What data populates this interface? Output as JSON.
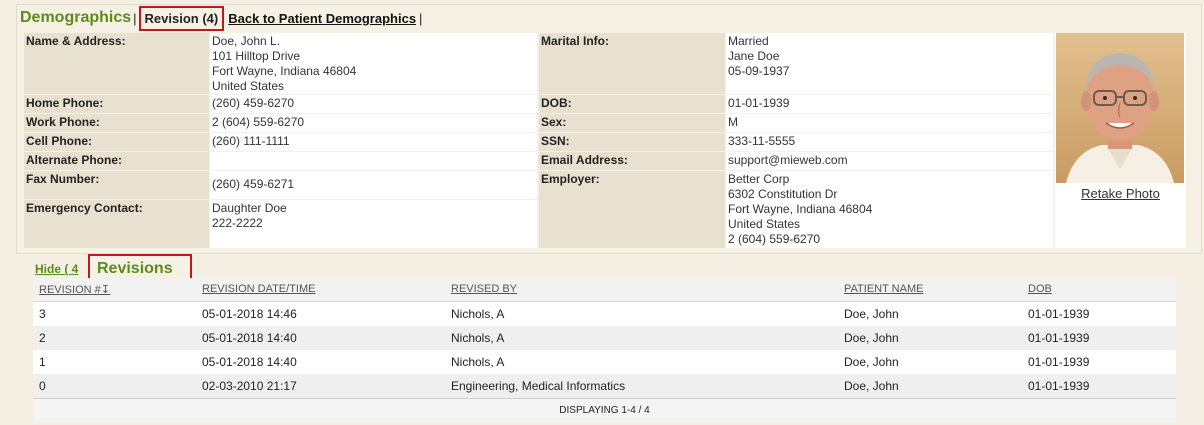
{
  "header": {
    "title": "Demographics",
    "separator": "|",
    "revision_tab": "Revision (4)",
    "back_link": "Back to Patient Demographics",
    "tail": "|"
  },
  "patient": {
    "name_address_label": "Name & Address:",
    "name": "Doe, John L.",
    "street": "101 Hilltop Drive",
    "city_state_zip": "Fort Wayne, Indiana 46804",
    "country": "United States",
    "home_phone_label": "Home Phone:",
    "home_phone": "(260) 459-6270",
    "work_phone_label": "Work Phone:",
    "work_phone": "2 (604) 559-6270",
    "cell_phone_label": "Cell Phone:",
    "cell_phone": "(260) 111-1111",
    "alt_phone_label": "Alternate Phone:",
    "alt_phone": "",
    "fax_label": "Fax Number:",
    "fax": "(260) 459-6271",
    "emergency_label": "Emergency Contact:",
    "emergency_name": "Daughter Doe",
    "emergency_phone": "222-2222",
    "marital_label": "Marital Info:",
    "marital_status": "Married",
    "spouse_name": "Jane Doe",
    "spouse_dob": "05-09-1937",
    "dob_label": "DOB:",
    "dob": "01-01-1939",
    "sex_label": "Sex:",
    "sex": "M",
    "ssn_label": "SSN:",
    "ssn": "333-11-5555",
    "email_label": "Email Address:",
    "email": "support@mieweb.com",
    "employer_label": "Employer:",
    "employer_name": "Better Corp",
    "employer_street": "6302 Constitution Dr",
    "employer_city": "Fort Wayne, Indiana 46804",
    "employer_country": "United States",
    "employer_phone": "2 (604) 559-6270",
    "retake_photo": "Retake Photo"
  },
  "revisions": {
    "hide_link": "Hide ( 4",
    "title": "Revisions",
    "columns": [
      "REVISION #",
      "REVISION DATE/TIME",
      "REVISED BY",
      "PATIENT NAME",
      "DOB"
    ],
    "sort_glyph": "↧",
    "rows": [
      {
        "rev": "3",
        "datetime": "05-01-2018 14:46",
        "by": "Nichols, A",
        "patient": "Doe, John",
        "dob": "01-01-1939"
      },
      {
        "rev": "2",
        "datetime": "05-01-2018 14:40",
        "by": "Nichols, A",
        "patient": "Doe, John",
        "dob": "01-01-1939"
      },
      {
        "rev": "1",
        "datetime": "05-01-2018 14:40",
        "by": "Nichols, A",
        "patient": "Doe, John",
        "dob": "01-01-1939"
      },
      {
        "rev": "0",
        "datetime": "02-03-2010 21:17",
        "by": "Engineering, Medical Informatics",
        "patient": "Doe, John",
        "dob": "01-01-1939"
      }
    ],
    "footer": "DISPLAYING 1-4 / 4"
  }
}
